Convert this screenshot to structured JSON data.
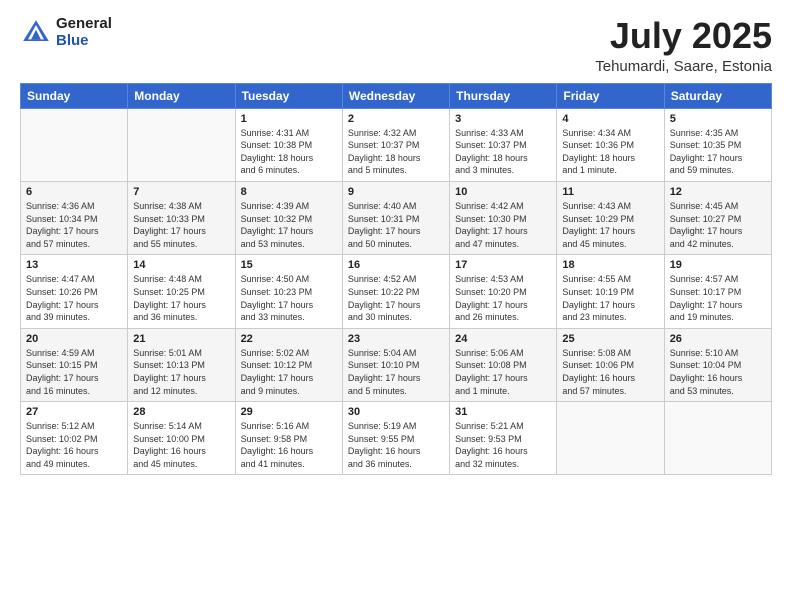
{
  "logo": {
    "general": "General",
    "blue": "Blue"
  },
  "header": {
    "month": "July 2025",
    "location": "Tehumardi, Saare, Estonia"
  },
  "weekdays": [
    "Sunday",
    "Monday",
    "Tuesday",
    "Wednesday",
    "Thursday",
    "Friday",
    "Saturday"
  ],
  "weeks": [
    [
      {
        "day": "",
        "info": ""
      },
      {
        "day": "",
        "info": ""
      },
      {
        "day": "1",
        "info": "Sunrise: 4:31 AM\nSunset: 10:38 PM\nDaylight: 18 hours\nand 6 minutes."
      },
      {
        "day": "2",
        "info": "Sunrise: 4:32 AM\nSunset: 10:37 PM\nDaylight: 18 hours\nand 5 minutes."
      },
      {
        "day": "3",
        "info": "Sunrise: 4:33 AM\nSunset: 10:37 PM\nDaylight: 18 hours\nand 3 minutes."
      },
      {
        "day": "4",
        "info": "Sunrise: 4:34 AM\nSunset: 10:36 PM\nDaylight: 18 hours\nand 1 minute."
      },
      {
        "day": "5",
        "info": "Sunrise: 4:35 AM\nSunset: 10:35 PM\nDaylight: 17 hours\nand 59 minutes."
      }
    ],
    [
      {
        "day": "6",
        "info": "Sunrise: 4:36 AM\nSunset: 10:34 PM\nDaylight: 17 hours\nand 57 minutes."
      },
      {
        "day": "7",
        "info": "Sunrise: 4:38 AM\nSunset: 10:33 PM\nDaylight: 17 hours\nand 55 minutes."
      },
      {
        "day": "8",
        "info": "Sunrise: 4:39 AM\nSunset: 10:32 PM\nDaylight: 17 hours\nand 53 minutes."
      },
      {
        "day": "9",
        "info": "Sunrise: 4:40 AM\nSunset: 10:31 PM\nDaylight: 17 hours\nand 50 minutes."
      },
      {
        "day": "10",
        "info": "Sunrise: 4:42 AM\nSunset: 10:30 PM\nDaylight: 17 hours\nand 47 minutes."
      },
      {
        "day": "11",
        "info": "Sunrise: 4:43 AM\nSunset: 10:29 PM\nDaylight: 17 hours\nand 45 minutes."
      },
      {
        "day": "12",
        "info": "Sunrise: 4:45 AM\nSunset: 10:27 PM\nDaylight: 17 hours\nand 42 minutes."
      }
    ],
    [
      {
        "day": "13",
        "info": "Sunrise: 4:47 AM\nSunset: 10:26 PM\nDaylight: 17 hours\nand 39 minutes."
      },
      {
        "day": "14",
        "info": "Sunrise: 4:48 AM\nSunset: 10:25 PM\nDaylight: 17 hours\nand 36 minutes."
      },
      {
        "day": "15",
        "info": "Sunrise: 4:50 AM\nSunset: 10:23 PM\nDaylight: 17 hours\nand 33 minutes."
      },
      {
        "day": "16",
        "info": "Sunrise: 4:52 AM\nSunset: 10:22 PM\nDaylight: 17 hours\nand 30 minutes."
      },
      {
        "day": "17",
        "info": "Sunrise: 4:53 AM\nSunset: 10:20 PM\nDaylight: 17 hours\nand 26 minutes."
      },
      {
        "day": "18",
        "info": "Sunrise: 4:55 AM\nSunset: 10:19 PM\nDaylight: 17 hours\nand 23 minutes."
      },
      {
        "day": "19",
        "info": "Sunrise: 4:57 AM\nSunset: 10:17 PM\nDaylight: 17 hours\nand 19 minutes."
      }
    ],
    [
      {
        "day": "20",
        "info": "Sunrise: 4:59 AM\nSunset: 10:15 PM\nDaylight: 17 hours\nand 16 minutes."
      },
      {
        "day": "21",
        "info": "Sunrise: 5:01 AM\nSunset: 10:13 PM\nDaylight: 17 hours\nand 12 minutes."
      },
      {
        "day": "22",
        "info": "Sunrise: 5:02 AM\nSunset: 10:12 PM\nDaylight: 17 hours\nand 9 minutes."
      },
      {
        "day": "23",
        "info": "Sunrise: 5:04 AM\nSunset: 10:10 PM\nDaylight: 17 hours\nand 5 minutes."
      },
      {
        "day": "24",
        "info": "Sunrise: 5:06 AM\nSunset: 10:08 PM\nDaylight: 17 hours\nand 1 minute."
      },
      {
        "day": "25",
        "info": "Sunrise: 5:08 AM\nSunset: 10:06 PM\nDaylight: 16 hours\nand 57 minutes."
      },
      {
        "day": "26",
        "info": "Sunrise: 5:10 AM\nSunset: 10:04 PM\nDaylight: 16 hours\nand 53 minutes."
      }
    ],
    [
      {
        "day": "27",
        "info": "Sunrise: 5:12 AM\nSunset: 10:02 PM\nDaylight: 16 hours\nand 49 minutes."
      },
      {
        "day": "28",
        "info": "Sunrise: 5:14 AM\nSunset: 10:00 PM\nDaylight: 16 hours\nand 45 minutes."
      },
      {
        "day": "29",
        "info": "Sunrise: 5:16 AM\nSunset: 9:58 PM\nDaylight: 16 hours\nand 41 minutes."
      },
      {
        "day": "30",
        "info": "Sunrise: 5:19 AM\nSunset: 9:55 PM\nDaylight: 16 hours\nand 36 minutes."
      },
      {
        "day": "31",
        "info": "Sunrise: 5:21 AM\nSunset: 9:53 PM\nDaylight: 16 hours\nand 32 minutes."
      },
      {
        "day": "",
        "info": ""
      },
      {
        "day": "",
        "info": ""
      }
    ]
  ]
}
